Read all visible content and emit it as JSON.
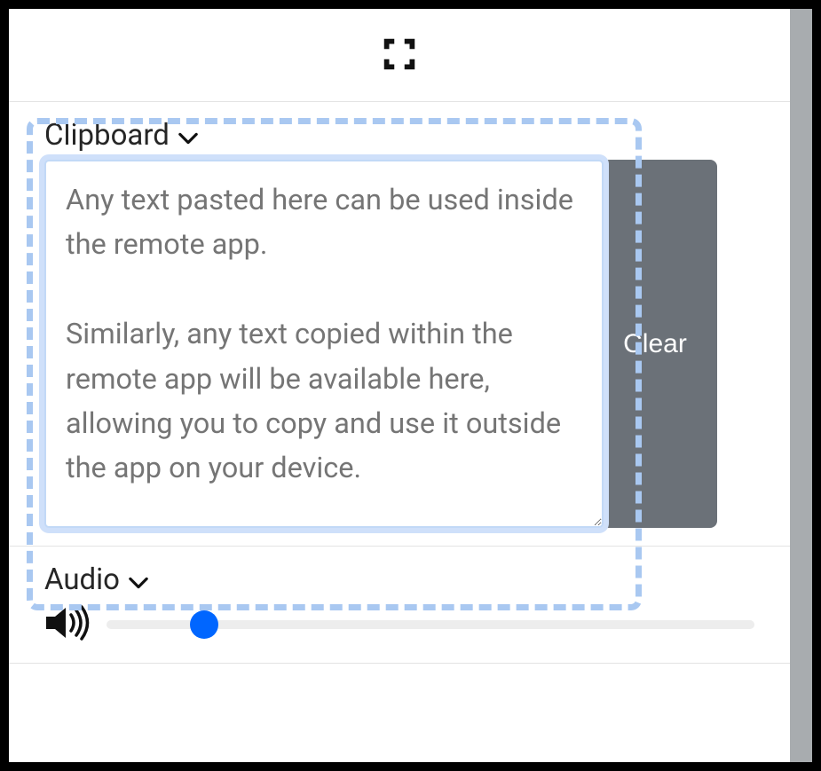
{
  "sections": {
    "clipboard": {
      "title": "Clipboard",
      "placeholder": "Any text pasted here can be used inside the remote app.\n\nSimilarly, any text copied within the remote app will be available here, allowing you to copy and use it outside the app on your device.",
      "clear_label": "Clear"
    },
    "audio": {
      "title": "Audio",
      "volume_percent": 15
    }
  }
}
